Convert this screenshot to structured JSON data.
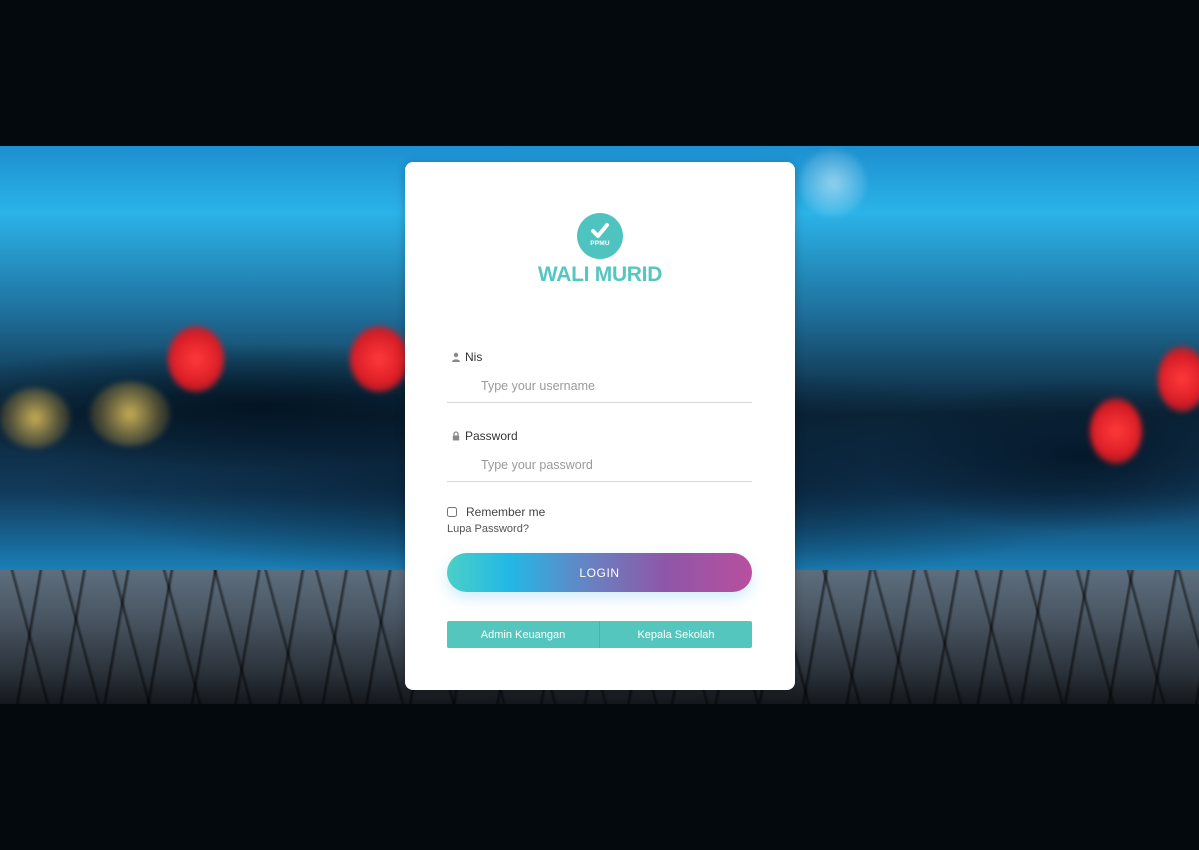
{
  "brand": {
    "badge_text": "PPMU",
    "title": "WALI MURID",
    "color": "#55c6c2"
  },
  "form": {
    "username": {
      "label": "Nis",
      "placeholder": "Type your username",
      "value": "",
      "icon": "user-icon"
    },
    "password": {
      "label": "Password",
      "placeholder": "Type your password",
      "value": "",
      "icon": "lock-icon"
    },
    "remember_label": "Remember me",
    "remember_checked": false,
    "forgot_label": "Lupa Password?",
    "login_label": "LOGIN"
  },
  "roles": [
    {
      "label": "Admin Keuangan"
    },
    {
      "label": "Kepala Sekolah"
    }
  ],
  "colors": {
    "accent": "#55c6be",
    "login_gradient_start": "#4ccfc7",
    "login_gradient_end": "#b94f9f"
  }
}
